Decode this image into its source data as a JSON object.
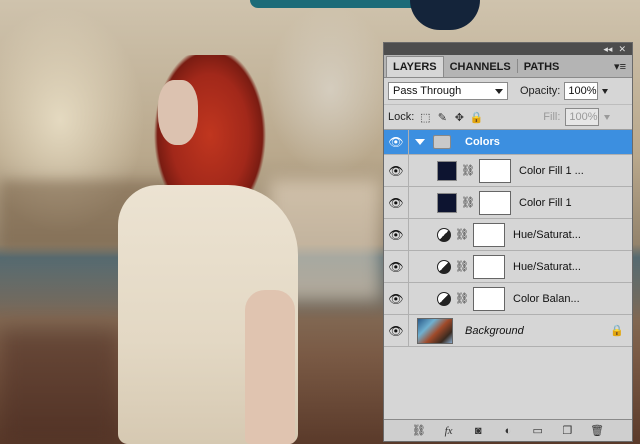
{
  "panel": {
    "tabs": [
      {
        "label": "LAYERS",
        "active": true
      },
      {
        "label": "CHANNELS",
        "active": false
      },
      {
        "label": "PATHS",
        "active": false
      }
    ],
    "blend_mode": "Pass Through",
    "opacity_label": "Opacity:",
    "opacity_value": "100%",
    "lock_label": "Lock:",
    "fill_label": "Fill:",
    "fill_value": "100%"
  },
  "layers": [
    {
      "name": "Colors",
      "type": "group",
      "selected": true
    },
    {
      "name": "Color Fill 1 ...",
      "type": "fill"
    },
    {
      "name": "Color Fill 1",
      "type": "fill"
    },
    {
      "name": "Hue/Saturat...",
      "type": "adjustment"
    },
    {
      "name": "Hue/Saturat...",
      "type": "adjustment"
    },
    {
      "name": "Color Balan...",
      "type": "adjustment"
    },
    {
      "name": "Background",
      "type": "background",
      "locked": true
    }
  ],
  "colors": {
    "selection": "#3c8fe0",
    "fill_swatch": "#0d1430",
    "panel_bg": "#d6d6d6"
  },
  "icons": {
    "visibility": "eye-icon",
    "link": "chain-icon",
    "footer": [
      "link-layers-icon",
      "fx-icon",
      "add-mask-icon",
      "adjustment-layer-icon",
      "new-group-icon",
      "new-layer-icon",
      "trash-icon"
    ]
  }
}
